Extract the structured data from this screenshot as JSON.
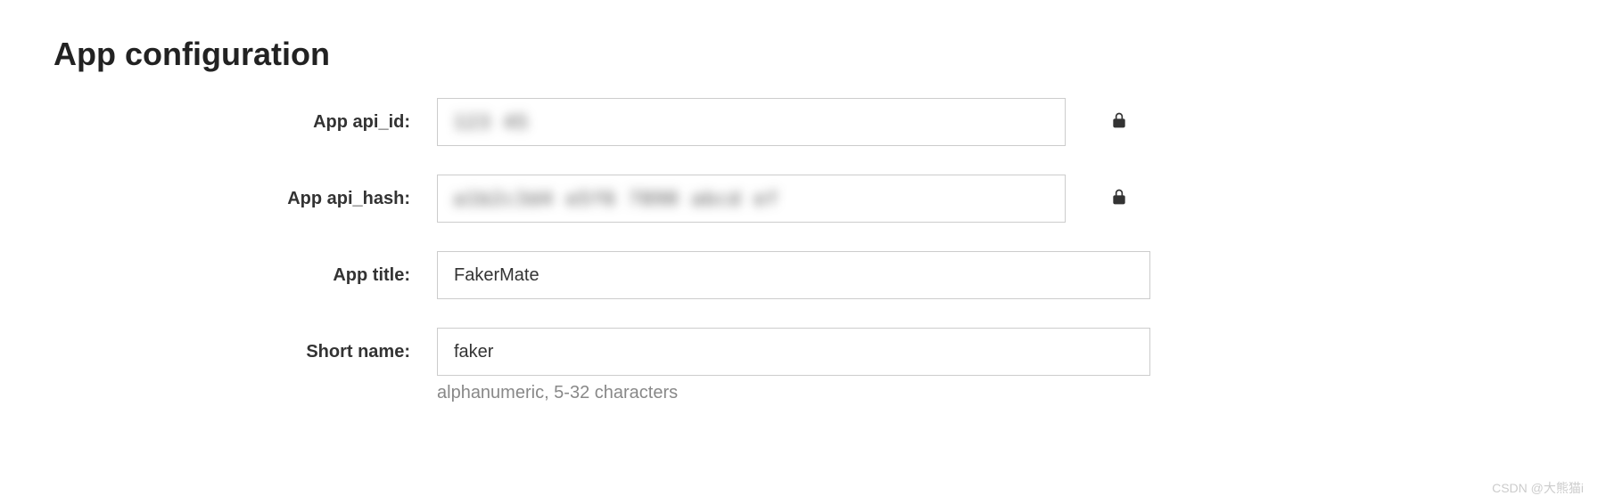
{
  "heading": "App configuration",
  "fields": {
    "api_id": {
      "label": "App api_id:",
      "value": "123 45",
      "locked": true
    },
    "api_hash": {
      "label": "App api_hash:",
      "value": "a1b2c3d4 e5f6 7890 abcd ef",
      "locked": true
    },
    "app_title": {
      "label": "App title:",
      "value": "FakerMate"
    },
    "short_name": {
      "label": "Short name:",
      "value": "faker",
      "helper": "alphanumeric, 5-32 characters"
    }
  },
  "watermark": "CSDN @大熊猫i"
}
